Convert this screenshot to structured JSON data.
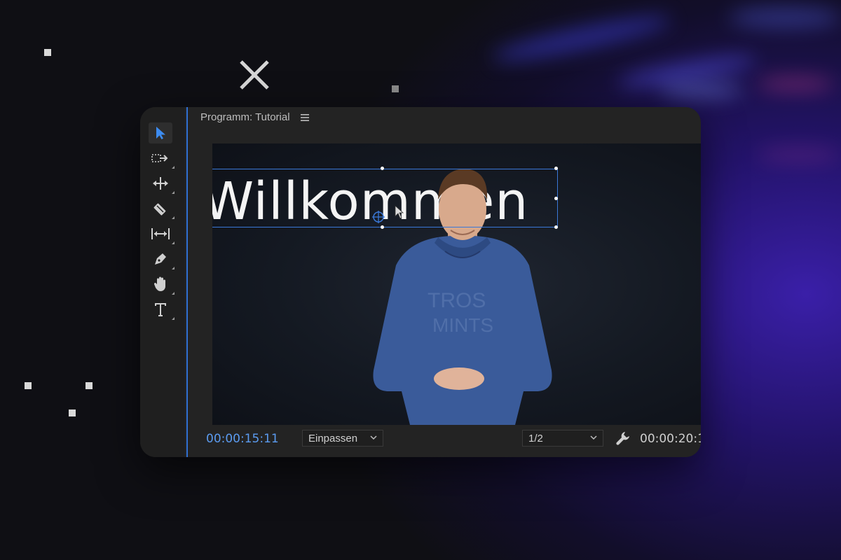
{
  "panel": {
    "title": "Programm: Tutorial"
  },
  "viewer": {
    "title_text": "Willkommen"
  },
  "bottom_bar": {
    "current_timecode": "00:00:15:11",
    "zoom_select": "Einpassen",
    "resolution_select": "1/2",
    "duration_timecode": "00:00:20:1"
  },
  "tools": [
    {
      "name": "selection-tool",
      "icon": "arrow-icon",
      "active": true
    },
    {
      "name": "track-select-tool",
      "icon": "track-select-icon"
    },
    {
      "name": "ripple-edit-tool",
      "icon": "ripple-edit-icon"
    },
    {
      "name": "razor-tool",
      "icon": "razor-icon"
    },
    {
      "name": "slip-tool",
      "icon": "slip-icon"
    },
    {
      "name": "pen-tool",
      "icon": "pen-icon"
    },
    {
      "name": "hand-tool",
      "icon": "hand-icon"
    },
    {
      "name": "type-tool",
      "icon": "type-icon"
    }
  ],
  "colors": {
    "accent_blue": "#2f6fd1",
    "timecode_blue": "#5b9bf0",
    "panel_bg": "#232323"
  }
}
